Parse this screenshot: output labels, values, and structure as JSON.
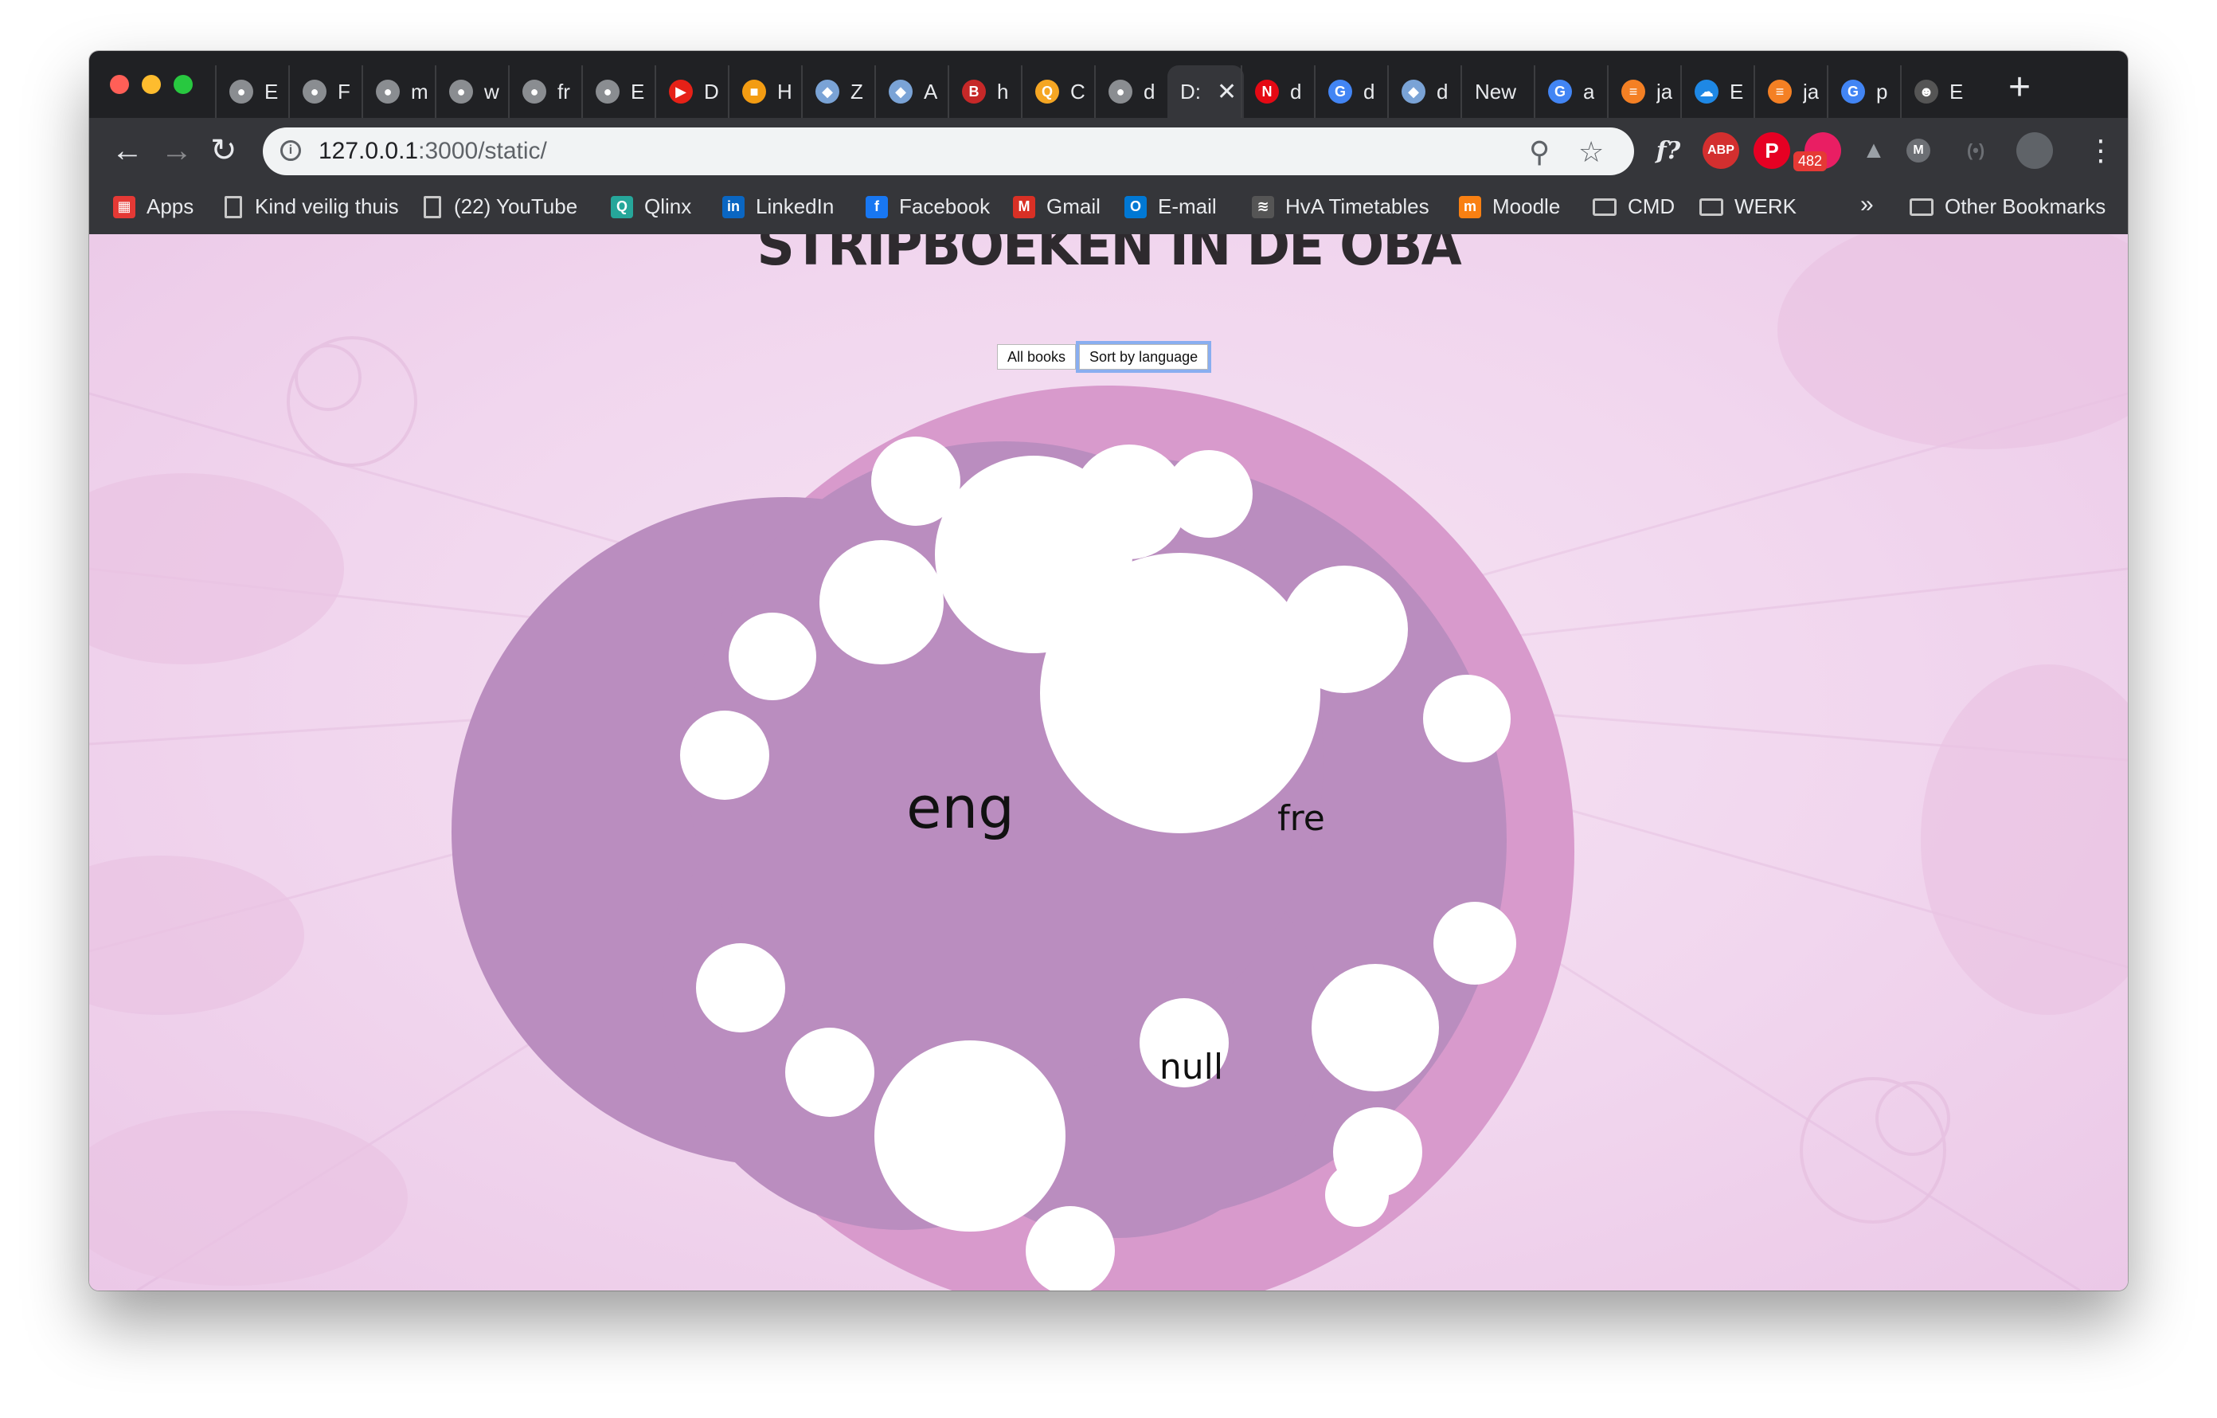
{
  "browser": {
    "tabs": [
      {
        "label": "E",
        "icon": "github-icon",
        "color": "#8a8d91"
      },
      {
        "label": "F",
        "icon": "github-icon",
        "color": "#8a8d91"
      },
      {
        "label": "m",
        "icon": "github-icon",
        "color": "#8a8d91"
      },
      {
        "label": "w",
        "icon": "github-icon",
        "color": "#8a8d91"
      },
      {
        "label": "fr",
        "icon": "github-icon",
        "color": "#8a8d91"
      },
      {
        "label": "E",
        "icon": "github-icon",
        "color": "#8a8d91"
      },
      {
        "label": "D",
        "icon": "youtube-icon",
        "color": "#e62117"
      },
      {
        "label": "H",
        "icon": "square-gradient-icon",
        "color": "#f39c12"
      },
      {
        "label": "Z",
        "icon": "cube-icon",
        "color": "#7aa3d6"
      },
      {
        "label": "A",
        "icon": "cube-icon",
        "color": "#7aa3d6"
      },
      {
        "label": "h",
        "icon": "bib-icon",
        "color": "#c62828"
      },
      {
        "label": "C",
        "icon": "search-box-icon",
        "color": "#f5a623"
      },
      {
        "label": "d",
        "icon": "github-icon",
        "color": "#8a8d91"
      },
      {
        "label": "D:",
        "icon": "none",
        "color": "#35363a",
        "active": true
      },
      {
        "label": "d",
        "icon": "netflix-icon",
        "color": "#e50914"
      },
      {
        "label": "d",
        "icon": "google-icon",
        "color": "#4285f4"
      },
      {
        "label": "d",
        "icon": "cube-icon",
        "color": "#7aa3d6"
      },
      {
        "label": "New",
        "icon": "none",
        "color": "#202124"
      },
      {
        "label": "a",
        "icon": "google-icon",
        "color": "#4285f4"
      },
      {
        "label": "ja",
        "icon": "stackoverflow-icon",
        "color": "#f48024"
      },
      {
        "label": "E",
        "icon": "cloud-icon",
        "color": "#1e88e5"
      },
      {
        "label": "ja",
        "icon": "stackoverflow-icon",
        "color": "#f48024"
      },
      {
        "label": "p",
        "icon": "google-icon",
        "color": "#4285f4"
      },
      {
        "label": "E",
        "icon": "avatar-icon",
        "color": "#555555"
      }
    ],
    "new_tab_glyph": "+",
    "close_glyph": "✕",
    "url_host": "127.0.0.1",
    "url_rest": ":3000/static/",
    "extension_badge": "482",
    "bookmarks": [
      {
        "label": "Apps",
        "icon": "apps-grid-icon"
      },
      {
        "label": "Kind veilig thuis",
        "icon": "page-icon"
      },
      {
        "label": "(22) YouTube",
        "icon": "page-icon"
      },
      {
        "label": "Qlinx",
        "icon": "qlinx-icon"
      },
      {
        "label": "LinkedIn",
        "icon": "linkedin-icon"
      },
      {
        "label": "Facebook",
        "icon": "facebook-icon"
      },
      {
        "label": "Gmail",
        "icon": "gmail-icon"
      },
      {
        "label": "E-mail",
        "icon": "outlook-icon"
      },
      {
        "label": "HvA Timetables",
        "icon": "wifi-icon"
      },
      {
        "label": "Moodle",
        "icon": "moodle-icon"
      },
      {
        "label": "CMD",
        "icon": "folder-icon"
      },
      {
        "label": "WERK",
        "icon": "folder-icon"
      }
    ],
    "overflow_glyph": "»",
    "other_bookmarks": "Other Bookmarks"
  },
  "page": {
    "title": "STRIPBOEKEN IN DE OBA",
    "buttons": {
      "all_books": "All books",
      "sort_by_language": "Sort by language"
    },
    "colors": {
      "outer_circle": "#d89acc",
      "group_circle": "#ba8dbf",
      "book": "#ffffff"
    }
  },
  "chart_data": {
    "type": "circle-packing",
    "title": "STRIPBOEKEN IN DE OBA",
    "groups": [
      {
        "name": "eng",
        "label": "eng"
      },
      {
        "name": "fre",
        "label": "fre"
      },
      {
        "name": "null",
        "label": "null"
      }
    ]
  }
}
